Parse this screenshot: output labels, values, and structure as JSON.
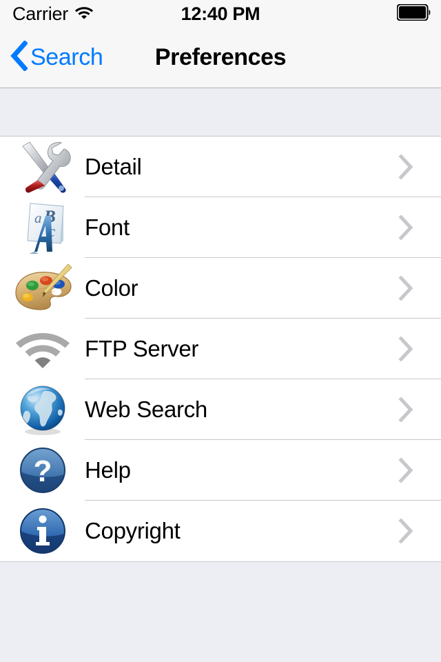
{
  "status_bar": {
    "carrier": "Carrier",
    "wifi_icon": "wifi-icon",
    "time": "12:40 PM",
    "battery_icon": "battery-full-icon"
  },
  "nav_bar": {
    "back_icon": "chevron-left-icon",
    "back_label": "Search",
    "title": "Preferences"
  },
  "colors": {
    "accent": "#007aff",
    "separator": "#c8c7cc",
    "chevron": "#c7c7cc",
    "group_background": "#eceef3",
    "cell_background": "#ffffff",
    "bar_background": "#f7f7f7"
  },
  "list": {
    "rows": [
      {
        "label": "Detail",
        "icon": "tools-icon",
        "accessory": "chevron-right-icon"
      },
      {
        "label": "Font",
        "icon": "font-icon",
        "accessory": "chevron-right-icon"
      },
      {
        "label": "Color",
        "icon": "palette-icon",
        "accessory": "chevron-right-icon"
      },
      {
        "label": "FTP Server",
        "icon": "wifi-gray-icon",
        "accessory": "chevron-right-icon"
      },
      {
        "label": "Web Search",
        "icon": "globe-icon",
        "accessory": "chevron-right-icon"
      },
      {
        "label": "Help",
        "icon": "question-icon",
        "accessory": "chevron-right-icon"
      },
      {
        "label": "Copyright",
        "icon": "info-icon",
        "accessory": "chevron-right-icon"
      }
    ]
  }
}
